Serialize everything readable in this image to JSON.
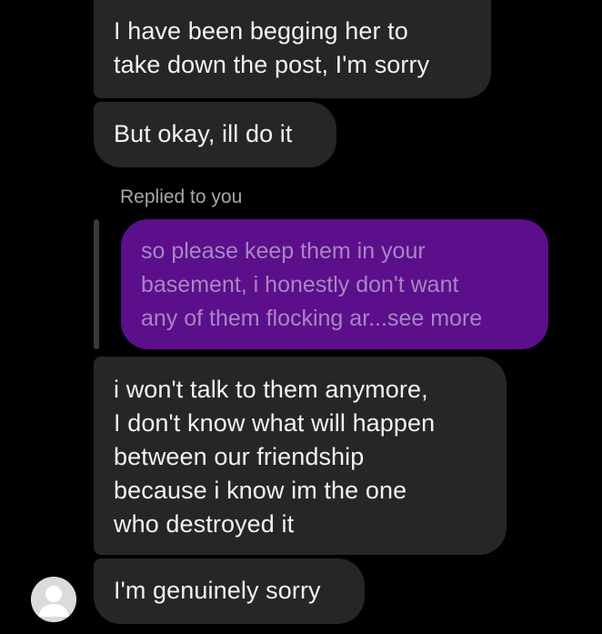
{
  "messages": [
    {
      "lines": [
        "I have been begging her to",
        "take down the post, I'm sorry"
      ]
    },
    {
      "lines": [
        "But okay, ill do it"
      ]
    },
    {
      "lines": [
        "i won't talk to them anymore,",
        "I don't know what will happen",
        "between our friendship",
        "because i know im the one",
        "who destroyed it"
      ]
    },
    {
      "lines": [
        "I'm genuinely sorry"
      ]
    }
  ],
  "reply": {
    "label": "Replied to you",
    "quoted_lines": [
      "so please keep them in your",
      "basement, i honestly don't want",
      "any of them flocking ar...see more"
    ]
  },
  "avatar": {
    "icon": "default-user-avatar-icon"
  },
  "colors": {
    "background": "#000000",
    "incoming_bubble": "#262626",
    "outgoing_bubble": "#5c0f8a",
    "quoted_text": "#a786c4",
    "label_text": "#a8a8a8"
  }
}
